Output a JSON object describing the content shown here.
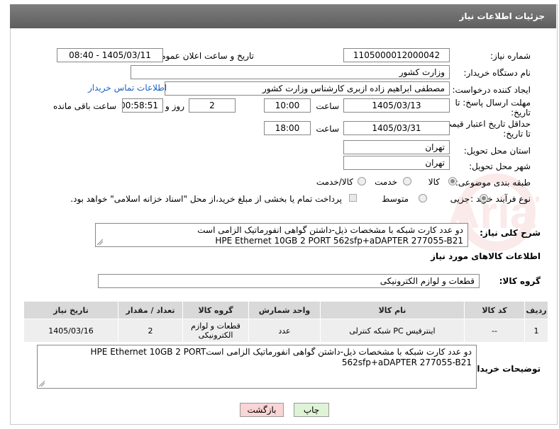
{
  "header": {
    "title": "جزئیات اطلاعات نیاز"
  },
  "fields": {
    "need_number_label": "شماره نیاز:",
    "need_number": "1105000012000042",
    "announce_label": "تاریخ و ساعت اعلان عمومی:",
    "announce_value": "1405/03/11 - 08:40",
    "buyer_org_label": "نام دستگاه خریدار:",
    "buyer_org": "وزارت کشور",
    "requester_label": "ایجاد کننده درخواست:",
    "requester": "مصطفی ابراهیم زاده ازبری کارشناس وزارت کشور",
    "buyer_contact_link": "اطلاعات تماس خریدار",
    "reply_deadline_label_1": "مهلت ارسال پاسخ: تا",
    "reply_deadline_label_2": "تاریخ:",
    "reply_date": "1405/03/13",
    "time_label": "ساعت",
    "reply_time": "10:00",
    "days_value": "2",
    "days_label": "روز و",
    "remaining_time": "00:58:51",
    "remaining_label": "ساعت باقی مانده",
    "price_validity_label_1": "حداقل تاریخ اعتبار قیمت:",
    "price_validity_label_2": "تا تاریخ:",
    "price_date": "1405/03/31",
    "price_time_label": "ساعت",
    "price_time": "18:00",
    "province_label": "استان محل تحویل:",
    "province": "تهران",
    "city_label": "شهر محل تحویل:",
    "city": "تهران",
    "category_label": "طبقه بندی موضوعی:",
    "category_options": [
      "کالا",
      "خدمت",
      "کالا/خدمت"
    ],
    "purchase_type_label": "نوع فرآیند خرید :",
    "purchase_options": [
      "جزیی",
      "متوسط"
    ],
    "payment_note": "پرداخت تمام یا بخشی از مبلغ خرید،از محل \"اسناد خزانه اسلامی\" خواهد بود."
  },
  "description": {
    "label": "شرح کلی نیاز:",
    "line1": "دو عدد کارت شبکه با مشخصات ذیل-داشتن گواهی انفورماتیک الزامی است",
    "line2": "HPE Ethernet 10GB 2 PORT 562sfp+aDAPTER    277055-B21"
  },
  "goods_info_title": "اطلاعات کالاهای مورد نیاز",
  "goods_group": {
    "label": "گروه کالا:",
    "value": "قطعات و لوازم الکترونیکی"
  },
  "table": {
    "headers": [
      "ردیف",
      "کد کالا",
      "نام کالا",
      "واحد شمارش",
      "گروه کالا",
      "تعداد / مقدار",
      "تاریخ نیاز"
    ],
    "rows": [
      [
        "1",
        "--",
        "اینترفیس PC شبکه کنترلی",
        "عدد",
        "قطعات و لوازم الکترونیکی",
        "2",
        "1405/03/16"
      ]
    ]
  },
  "buyer_notes": {
    "label": "توضیحات خریدار:",
    "line1": "دو عدد کارت شبکه با مشخصات ذیل-داشتن گواهی انفورماتیک الزامی استHPE Ethernet 10GB 2 PORT",
    "line2": "562sfp+aDAPTER    277055-B21"
  },
  "buttons": {
    "print": "چاپ",
    "back": "بازگشت"
  },
  "watermark_text": "AriaTender.neT",
  "colors": {
    "header_bg": "#6e6e6e",
    "link": "#1c63c7",
    "back_btn_bg": "#f9d5d5",
    "print_btn_bg": "#dff3d6"
  }
}
